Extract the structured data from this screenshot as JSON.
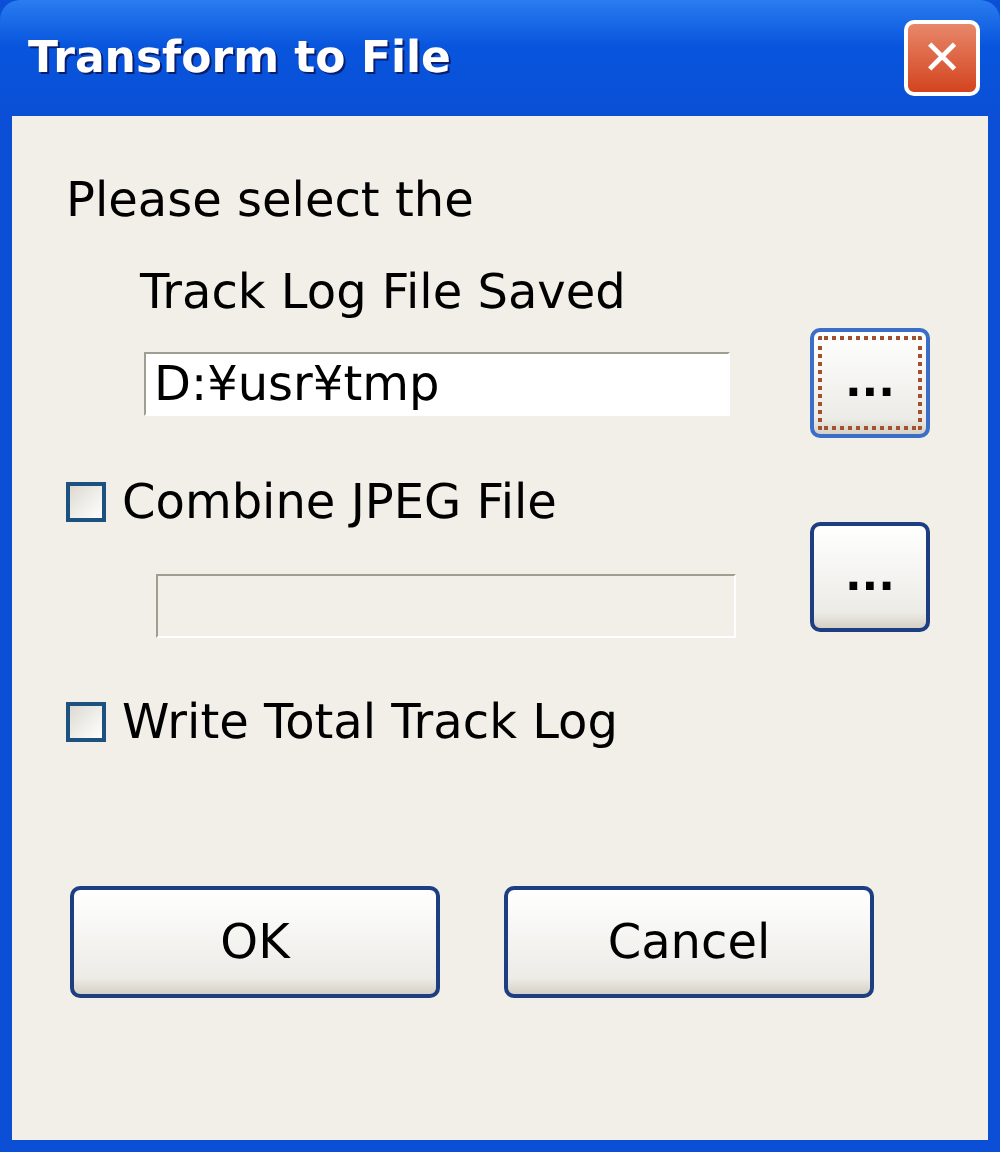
{
  "window": {
    "title": "Transform to File",
    "close": "✕"
  },
  "prompt": [
    "Please select the",
    "Track Log File Saved"
  ],
  "directory": {
    "value": "D:¥usr¥tmp",
    "disabled": false,
    "browse": {
      "label": "...",
      "focused": true
    }
  },
  "options": [
    {
      "label": "Combine JPEG File",
      "checked": false,
      "field": {
        "disabled": true
      },
      "browse": {
        "label": "...",
        "focused": false
      }
    },
    {
      "label": "Write Total Track Log",
      "checked": false
    }
  ],
  "buttons": [
    "OK",
    "Cancel"
  ]
}
